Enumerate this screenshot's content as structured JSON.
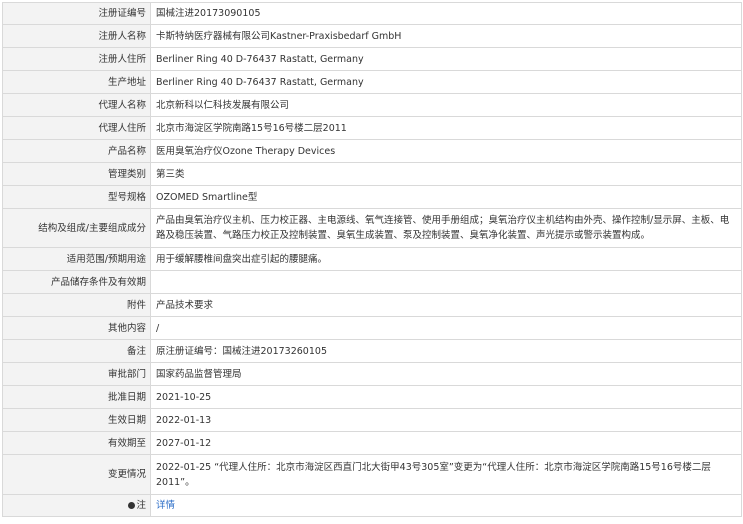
{
  "rows": [
    {
      "label": "注册证编号",
      "value": "国械注进20173090105"
    },
    {
      "label": "注册人名称",
      "value": "卡斯特纳医疗器械有限公司Kastner-Praxisbedarf GmbH"
    },
    {
      "label": "注册人住所",
      "value": "Berliner Ring 40 D-76437 Rastatt, Germany"
    },
    {
      "label": "生产地址",
      "value": "Berliner Ring 40 D-76437 Rastatt, Germany"
    },
    {
      "label": "代理人名称",
      "value": "北京新科以仁科技发展有限公司"
    },
    {
      "label": "代理人住所",
      "value": "北京市海淀区学院南路15号16号楼二层2011"
    },
    {
      "label": "产品名称",
      "value": "医用臭氧治疗仪Ozone Therapy Devices"
    },
    {
      "label": "管理类别",
      "value": "第三类"
    },
    {
      "label": "型号规格",
      "value": "OZOMED Smartline型"
    },
    {
      "label": "结构及组成/主要组成成分",
      "value": "产品由臭氧治疗仪主机、压力校正器、主电源线、氧气连接管、使用手册组成；臭氧治疗仪主机结构由外壳、操作控制/显示屏、主板、电路及稳压装置、气路压力校正及控制装置、臭氧生成装置、泵及控制装置、臭氧净化装置、声光提示或警示装置构成。"
    },
    {
      "label": "适用范围/预期用途",
      "value": "用于缓解腰椎间盘突出症引起的腰腿痛。"
    },
    {
      "label": "产品储存条件及有效期",
      "value": ""
    },
    {
      "label": "附件",
      "value": "产品技术要求"
    },
    {
      "label": "其他内容",
      "value": "/"
    },
    {
      "label": "备注",
      "value": "原注册证编号：国械注进20173260105"
    },
    {
      "label": "审批部门",
      "value": "国家药品监督管理局"
    },
    {
      "label": "批准日期",
      "value": "2021-10-25"
    },
    {
      "label": "生效日期",
      "value": "2022-01-13"
    },
    {
      "label": "有效期至",
      "value": "2027-01-12"
    },
    {
      "label": "变更情况",
      "value": "2022-01-25 “代理人住所：北京市海淀区西直门北大街甲43号305室”变更为“代理人住所：北京市海淀区学院南路15号16号楼二层2011”。"
    }
  ],
  "note_row": {
    "label": "注",
    "link": "详情"
  },
  "colors": {
    "label_bg": "#f3f3f3",
    "border": "#d9d9d9",
    "link": "#2a6cc7"
  }
}
